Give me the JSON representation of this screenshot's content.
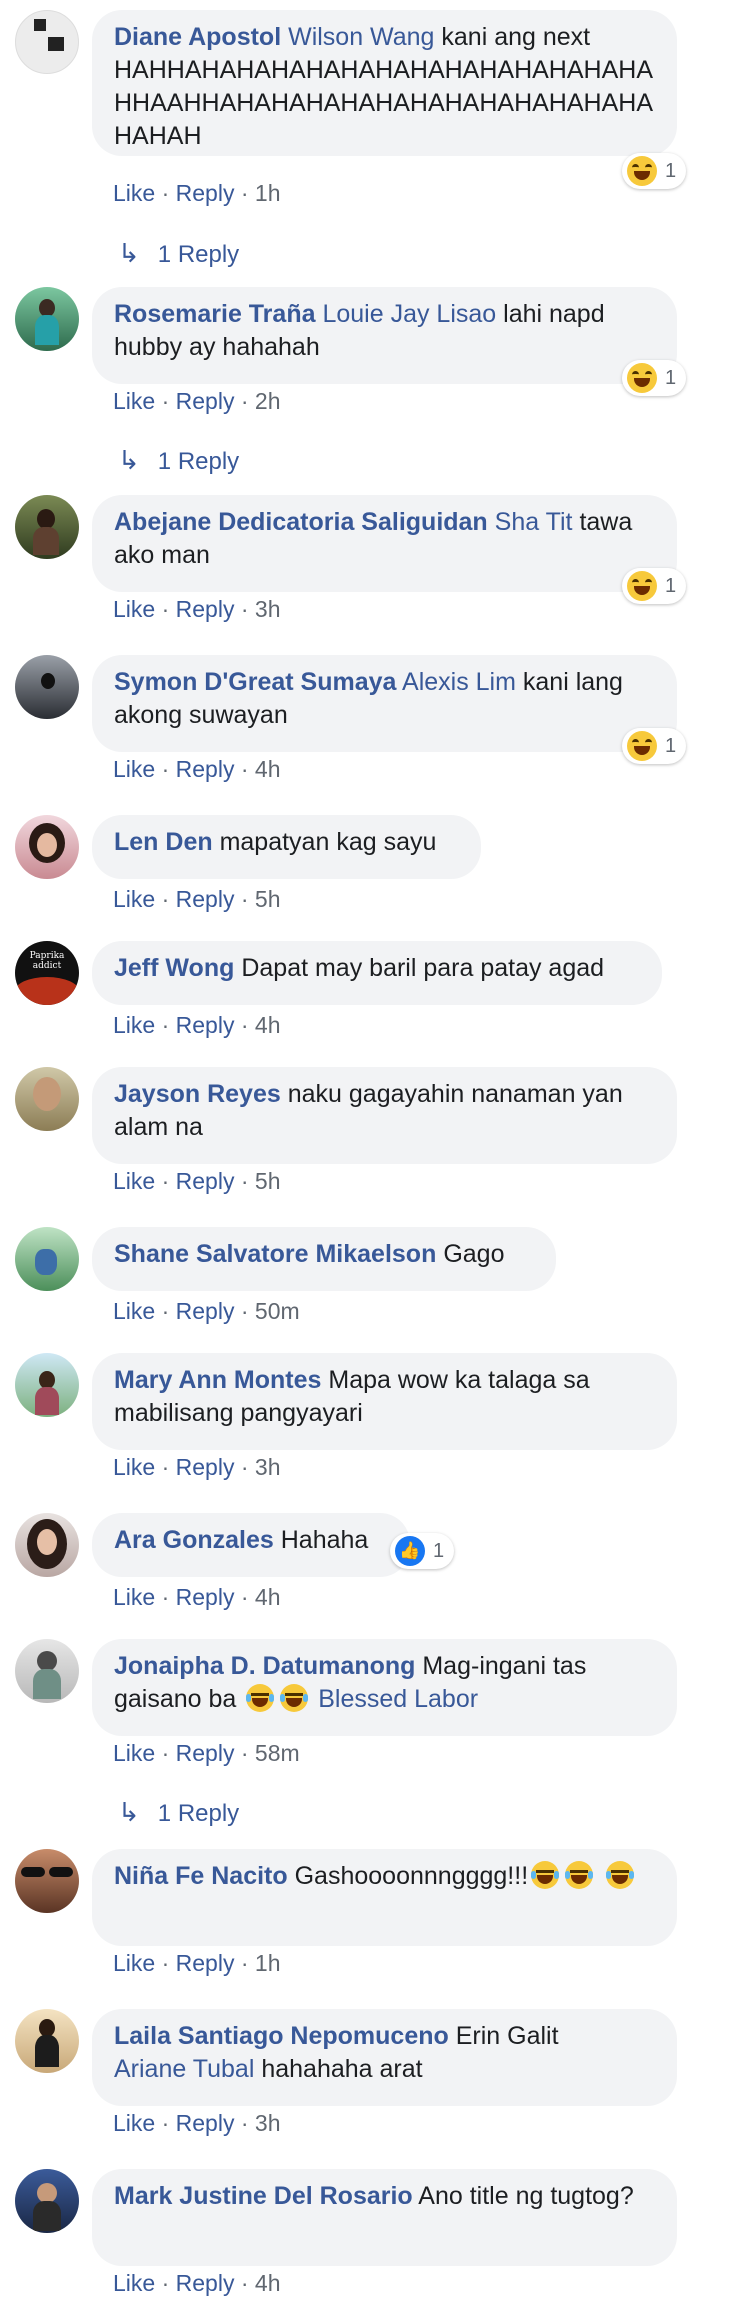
{
  "actions": {
    "like": "Like",
    "reply": "Reply",
    "dot": " · "
  },
  "reply_link": "1 Reply",
  "comments": [
    {
      "author": "Diane Apostol",
      "tag": "Wilson Wang",
      "text_lines": [
        "kani ang next",
        "HAHHAHAHAHAHAHAHAHAHAHAHAHAHAHA",
        "HHAAHHAHAHAHAHAHAHAHAHAHAHAHAHA",
        "HAHAH"
      ],
      "time": "1h",
      "reaction": {
        "type": "haha",
        "count": "1"
      },
      "replies": "1 Reply"
    },
    {
      "author": "Rosemarie Traña",
      "tag": "Louie Jay Lisao",
      "text": "lahi napd hubby ay hahahah",
      "time": "2h",
      "reaction": {
        "type": "haha",
        "count": "1"
      },
      "replies": "1 Reply"
    },
    {
      "author": "Abejane Dedicatoria Saliguidan",
      "tag": "Sha Tit",
      "text": "tawa ako man",
      "time": "3h",
      "reaction": {
        "type": "haha",
        "count": "1"
      }
    },
    {
      "author": "Symon D'Great Sumaya",
      "tag": "Alexis Lim",
      "text": "kani lang akong suwayan",
      "time": "4h",
      "reaction": {
        "type": "haha",
        "count": "1"
      }
    },
    {
      "author": "Len Den",
      "text": "mapatyan kag sayu",
      "time": "5h"
    },
    {
      "author": "Jeff Wong",
      "text": "Dapat may baril para patay agad",
      "time": "4h",
      "avatar_text": "Paprika addict"
    },
    {
      "author": "Jayson Reyes",
      "text": "naku gagayahin nanaman yan alam na",
      "time": "5h"
    },
    {
      "author": "Shane Salvatore Mikaelson",
      "text": "Gago",
      "time": "50m"
    },
    {
      "author": "Mary Ann Montes",
      "text": "Mapa wow ka talaga sa mabilisang pangyayari",
      "time": "3h"
    },
    {
      "author": "Ara Gonzales",
      "text": "Hahaha",
      "time": "4h",
      "reaction": {
        "type": "like",
        "count": "1"
      }
    },
    {
      "author": "Jonaipha D. Datumanong",
      "text": "Mag-ingani tas gaisano ba",
      "tag_after": "Blessed Labor",
      "time": "58m",
      "replies": "1 Reply"
    },
    {
      "author": "Niña Fe Nacito",
      "text": "Gashoooonnngggg!!!",
      "time": "1h"
    },
    {
      "author": "Laila Santiago Nepomuceno",
      "tag": "Erin Galit",
      "tag2": "Ariane Tubal",
      "text": "hahahaha arat",
      "time": "3h"
    },
    {
      "author": "Mark Justine Del Rosario",
      "text": "Ano title ng tugtog?",
      "time": "4h"
    }
  ]
}
